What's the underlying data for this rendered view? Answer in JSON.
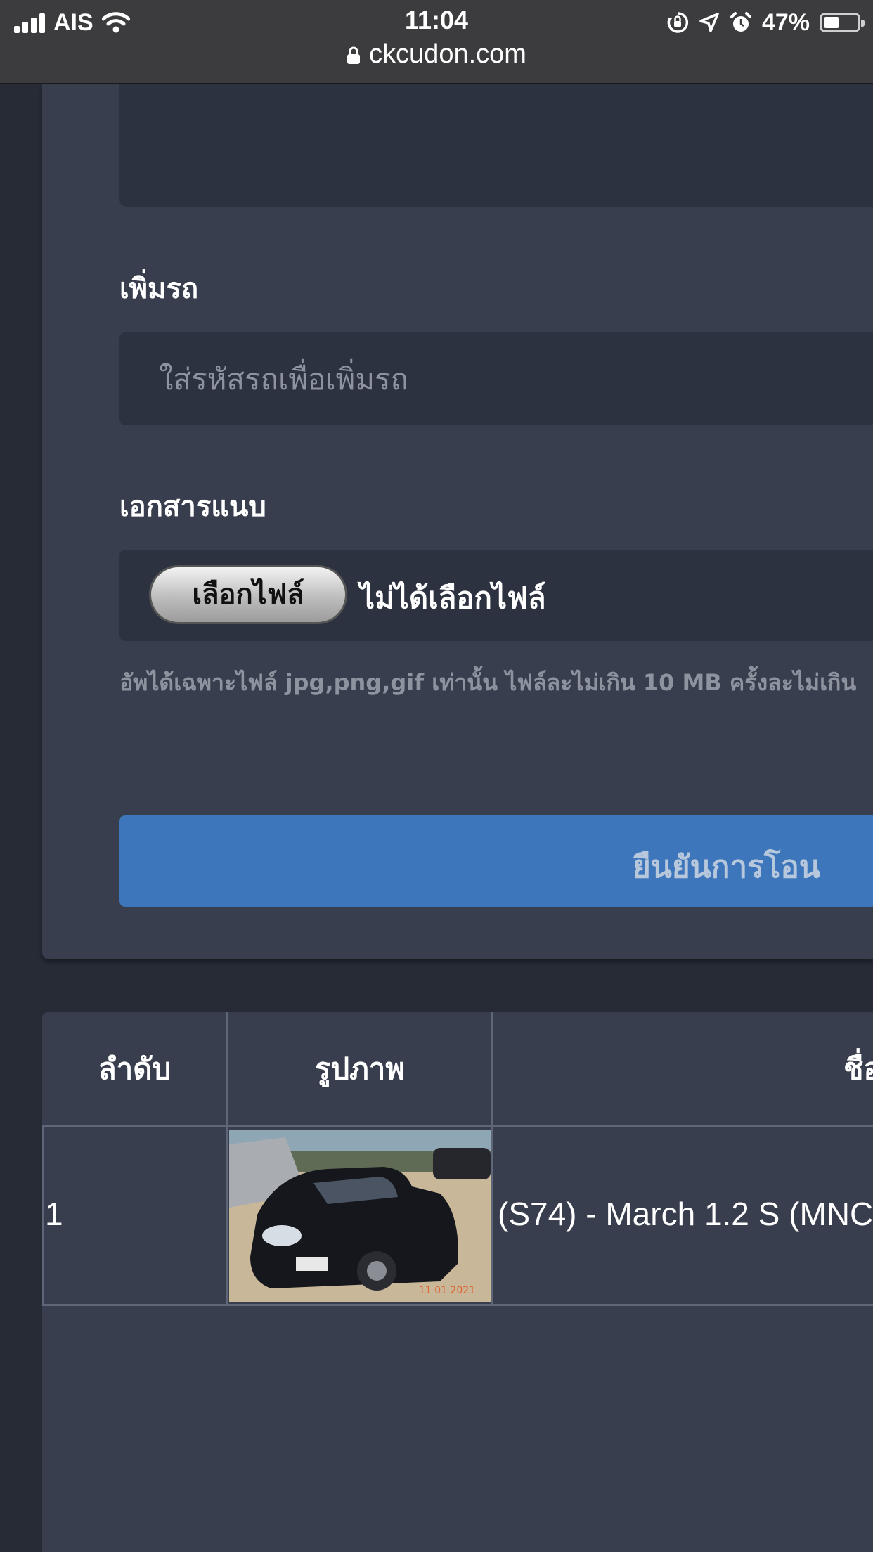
{
  "status_bar": {
    "carrier": "AIS",
    "time": "11:04",
    "battery": "47%",
    "url": "ckcudon.com"
  },
  "form": {
    "add_car_label": "เพิ่มรถ",
    "add_car_placeholder": "ใส่รหัสรถเพื่อเพิ่มรถ",
    "attachment_label": "เอกสารแนบ",
    "choose_file_label": "เลือกไฟล์",
    "no_file_chosen": "ไม่ได้เลือกไฟล์",
    "upload_hint": "อัพได้เฉพาะไฟล์ jpg,png,gif เท่านั้น ไฟล์ละไม่เกิน 10 MB ครั้งละไม่เกิน",
    "confirm_button": "ยืนยันการโอน"
  },
  "table": {
    "headers": [
      "ลำดับ",
      "รูปภาพ",
      "ชื่อ"
    ],
    "rows": [
      {
        "index": "1",
        "image": "car-photo",
        "name": "(S74) - March 1.2 S (MNC"
      }
    ]
  },
  "colors": {
    "background": "#262b36",
    "card": "#383e4d",
    "input": "#2d3241",
    "primary_button": "#3e76bb"
  }
}
